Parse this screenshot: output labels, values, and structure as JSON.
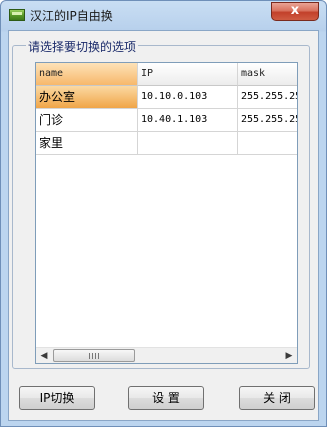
{
  "window": {
    "title": "汉江的IP自由换",
    "close_glyph": "x"
  },
  "group": {
    "label": "请选择要切换的选项"
  },
  "table": {
    "columns": [
      "name",
      "IP",
      "mask"
    ],
    "rows": [
      {
        "name": "办公室",
        "ip": "10.10.0.103",
        "mask": "255.255.25"
      },
      {
        "name": "门诊",
        "ip": "10.40.1.103",
        "mask": "255.255.25"
      },
      {
        "name": "家里",
        "ip": "",
        "mask": ""
      }
    ],
    "selected_row": 0
  },
  "scrollbar": {
    "left_arrow": "◀",
    "right_arrow": "▶"
  },
  "buttons": {
    "switch": "IP切换",
    "settings": "设 置",
    "close": "关 闭"
  }
}
